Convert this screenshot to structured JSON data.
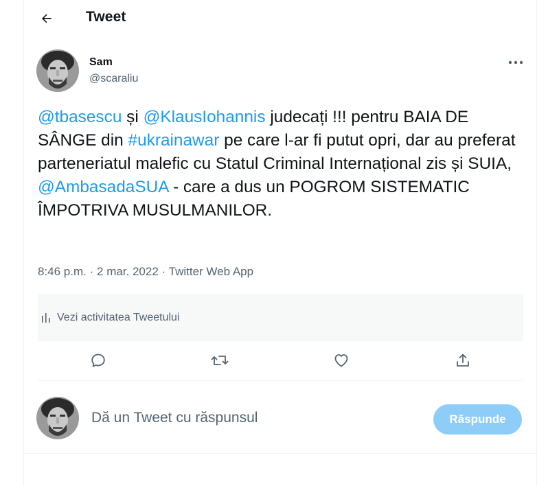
{
  "header": {
    "title": "Tweet",
    "back_icon": "arrow-left-icon"
  },
  "author": {
    "name": "Sam",
    "handle": "@scaraliu"
  },
  "tweet": {
    "segments": [
      {
        "text": "@tbasescu",
        "link": true
      },
      {
        "text": " și ",
        "link": false
      },
      {
        "text": "@KlausIohannis",
        "link": true
      },
      {
        "text": " judecați !!! pentru BAIA DE SÂNGE din ",
        "link": false
      },
      {
        "text": "#ukrainawar",
        "link": true
      },
      {
        "text": " pe care l-ar fi putut opri, dar au preferat parteneriatul malefic cu Statul Criminal Internațional zis și SUIA, ",
        "link": false
      },
      {
        "text": "@AmbasadaSUA",
        "link": true
      },
      {
        "text": " - care a dus un POGROM SISTEMATIC ÎMPOTRIVA MUSULMANILOR.",
        "link": false
      }
    ],
    "time": "8:46 p.m.",
    "date": "2 mar. 2022",
    "source": "Twitter Web App",
    "separator": "·"
  },
  "activity": {
    "label": "Vezi activitatea Tweetului",
    "icon": "bar-chart-icon"
  },
  "actions": {
    "reply_icon": "reply-icon",
    "retweet_icon": "retweet-icon",
    "like_icon": "heart-icon",
    "share_icon": "share-icon"
  },
  "reply_box": {
    "placeholder": "Dă un Tweet cu răspunsul",
    "button_label": "Răspunde"
  },
  "colors": {
    "link": "#1d9bf0",
    "secondary_text": "#536471",
    "reply_button_bg": "#8ecdf8",
    "activity_bg": "#f7f9f9"
  }
}
